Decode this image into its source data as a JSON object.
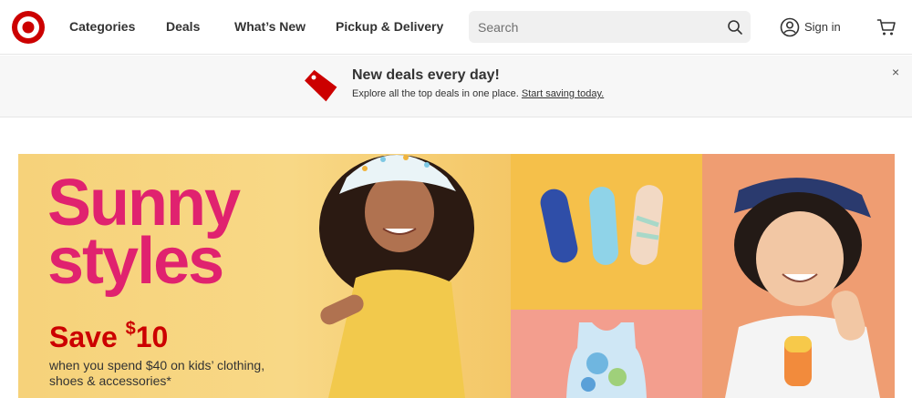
{
  "header": {
    "nav": [
      "Categories",
      "Deals",
      "What’s New",
      "Pickup & Delivery"
    ],
    "search_placeholder": "Search",
    "signin_label": "Sign in",
    "icons": {
      "logo": "target-bullseye-logo",
      "search": "search-icon",
      "account": "account-icon",
      "cart": "cart-icon"
    }
  },
  "promo": {
    "title": "New deals every day!",
    "text": "Explore all the top deals in one place.",
    "link": "Start saving today.",
    "close": "×"
  },
  "hero": {
    "title_line1": "Sunny",
    "title_line2": "styles",
    "save_prefix": "Save ",
    "save_dollar": "$",
    "save_amount": "10",
    "description": "when you spend $40 on kids’ clothing, shoes & accessories*"
  },
  "colors": {
    "brand_red": "#cc0000",
    "hero_pink": "#e0226f",
    "hero_yellow": "#f8d886",
    "shoes_yellow": "#f5c04a",
    "coral": "#ef9d72",
    "salmon": "#f39e8e"
  }
}
